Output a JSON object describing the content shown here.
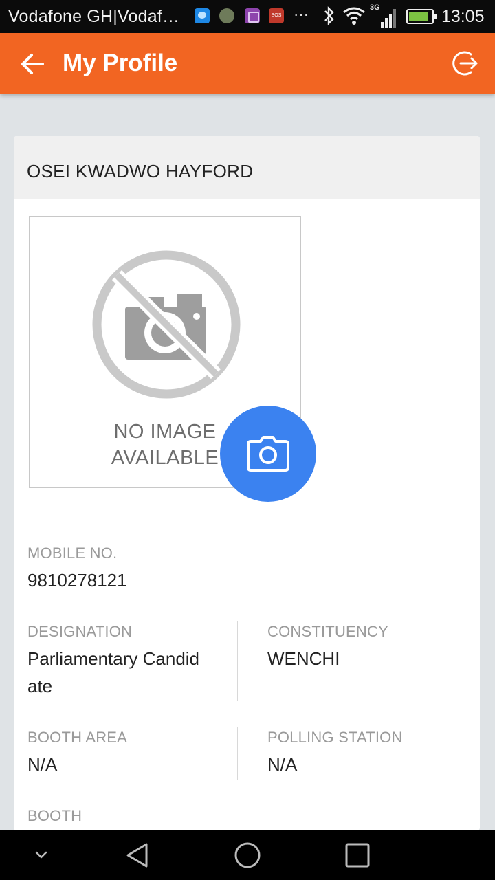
{
  "status_bar": {
    "carrier": "Vodafone GH|Vodaf…",
    "network": "3G",
    "time": "13:05",
    "sos_label": "SOS"
  },
  "app_bar": {
    "title": "My Profile",
    "back_icon": "arrow-left-icon",
    "logout_icon": "logout-icon",
    "color": "#f26522"
  },
  "profile": {
    "name": "OSEI KWADWO HAYFORD",
    "photo_placeholder_line1": "NO IMAGE",
    "photo_placeholder_line2": "AVAILABLE",
    "camera_icon": "camera-icon",
    "fields": {
      "mobile": {
        "label": "MOBILE NO.",
        "value": "9810278121"
      },
      "designation": {
        "label": "DESIGNATION",
        "value_line1": "Parliamentary Candid",
        "value_line2": "ate"
      },
      "constituency": {
        "label": "CONSTITUENCY",
        "value": "WENCHI"
      },
      "booth_area": {
        "label": "BOOTH AREA",
        "value": "N/A"
      },
      "polling_station": {
        "label": "POLLING STATION",
        "value": "N/A"
      },
      "booth": {
        "label": "BOOTH"
      }
    }
  },
  "colors": {
    "accent": "#f26522",
    "camera_button": "#3b82f0"
  }
}
